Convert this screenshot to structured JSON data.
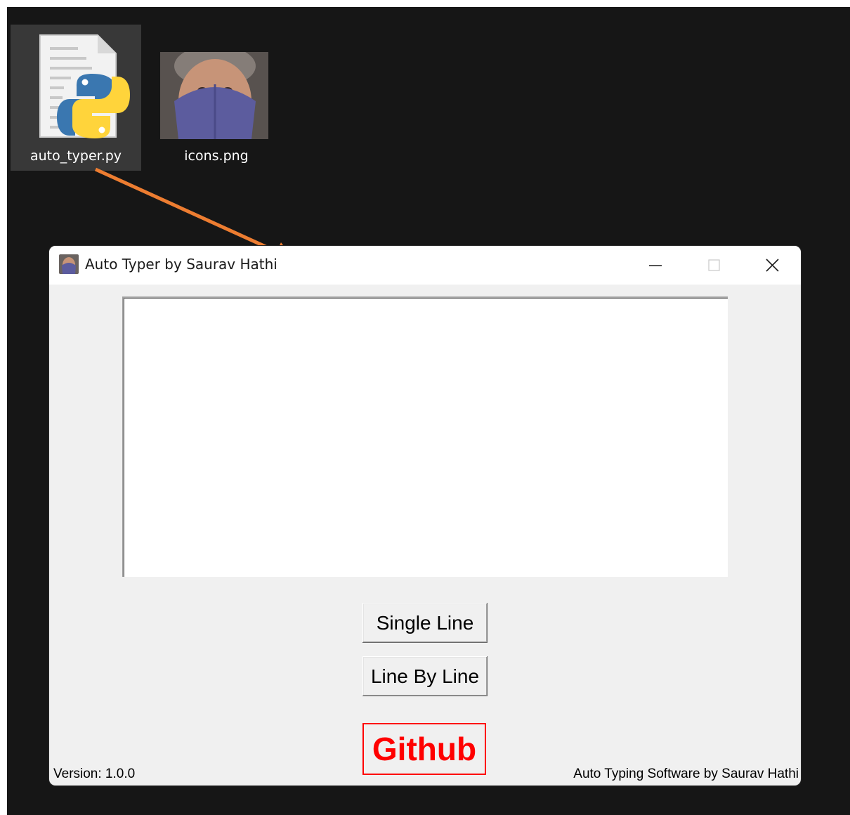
{
  "desktop": {
    "icons": [
      {
        "label": "auto_typer.py",
        "icon": "python-file-icon",
        "selected": true
      },
      {
        "label": "icons.png",
        "icon": "image-thumbnail-icon",
        "selected": false
      }
    ],
    "arrow_color": "#ed7d31"
  },
  "window": {
    "title": "Auto Typer by Saurav Hathi",
    "controls": [
      "minimize-icon",
      "maximize-icon",
      "close-icon"
    ],
    "text_area_value": "",
    "buttons": {
      "single_line": "Single Line",
      "line_by_line": "Line By Line",
      "github": "Github"
    },
    "footer": {
      "version": "Version: 1.0.0",
      "credit": "Auto Typing Software by Saurav Hathi"
    }
  },
  "colors": {
    "github_red": "#ff0000",
    "window_bg": "#f0f0f0",
    "desktop_bg": "#161616"
  }
}
